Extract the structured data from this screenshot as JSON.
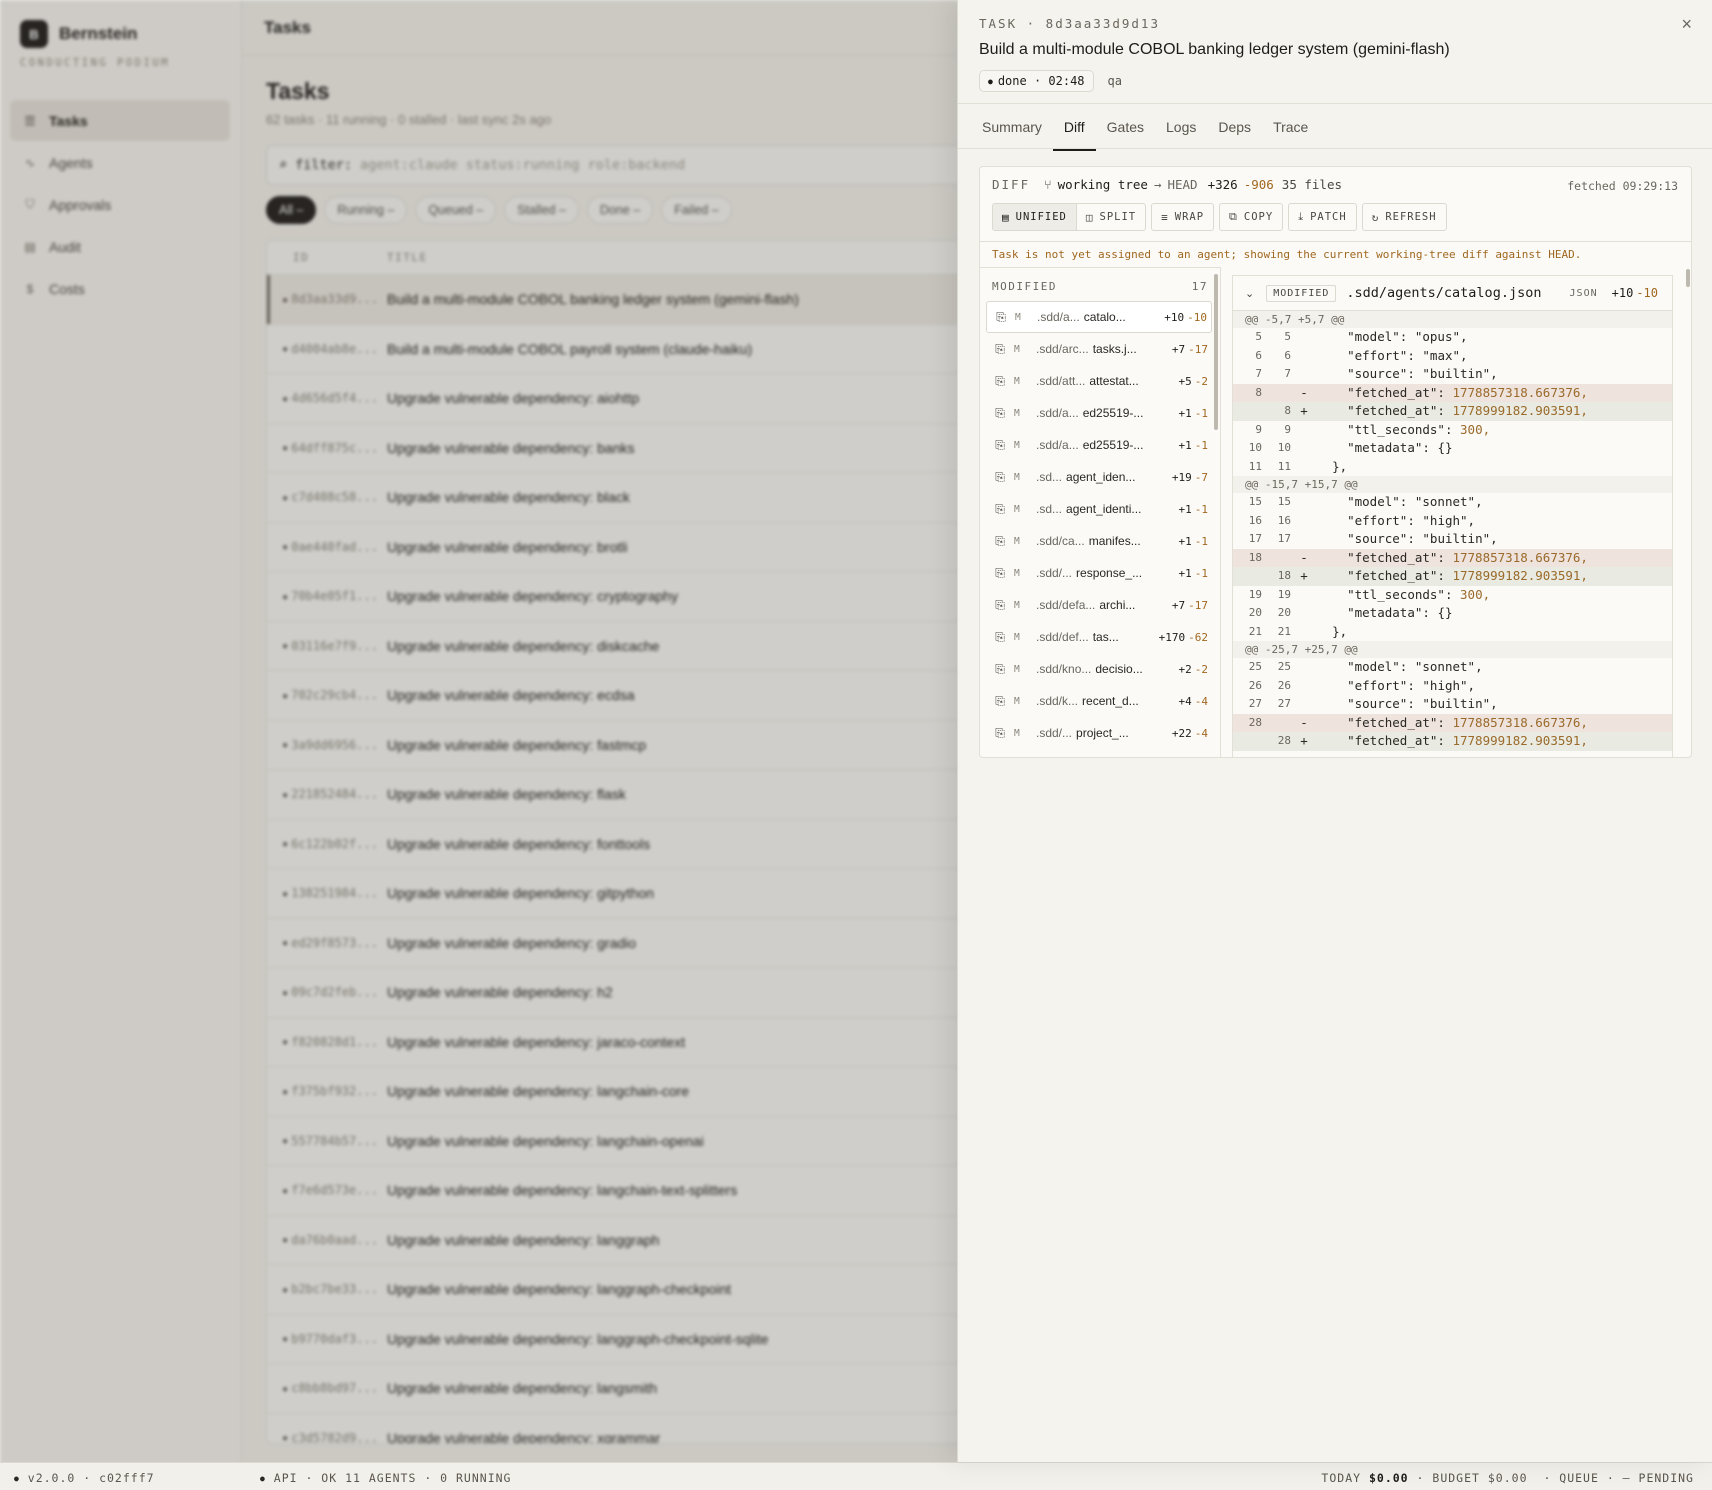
{
  "app": {
    "brand": "Bernstein",
    "logo_letter": "B",
    "tagline": "CONDUCTING PODIUM",
    "nav": [
      {
        "label": "Tasks",
        "icon": "list-icon",
        "active": true
      },
      {
        "label": "Agents",
        "icon": "pulse-icon",
        "active": false
      },
      {
        "label": "Approvals",
        "icon": "shield-check-icon",
        "active": false
      },
      {
        "label": "Audit",
        "icon": "ledger-icon",
        "active": false
      },
      {
        "label": "Costs",
        "icon": "dollar-icon",
        "active": false
      }
    ]
  },
  "main": {
    "topbar_title": "Tasks",
    "page_title": "Tasks",
    "summary": "62 tasks · 11 running · 0 stalled · last sync 2s  ago",
    "filter_key": "filter:",
    "filter_placeholder": "agent:claude status:running role:backend",
    "chips": [
      "All –",
      "Running –",
      "Queued –",
      "Stalled –",
      "Done –",
      "Failed –"
    ],
    "columns": {
      "id": "ID",
      "title": "TITLE"
    },
    "rows": [
      {
        "id": "8d3aa33d9...",
        "title": "Build a multi-module COBOL banking ledger system (gemini-flash)"
      },
      {
        "id": "d4004ab8e...",
        "title": "Build a multi-module COBOL payroll system (claude-haiku)"
      },
      {
        "id": "4d656d5f4...",
        "title": "Upgrade vulnerable dependency: aiohttp"
      },
      {
        "id": "64dff875c...",
        "title": "Upgrade vulnerable dependency: banks"
      },
      {
        "id": "c7d408c58...",
        "title": "Upgrade vulnerable dependency: black"
      },
      {
        "id": "0ae440fad...",
        "title": "Upgrade vulnerable dependency: brotli"
      },
      {
        "id": "70b4e05f1...",
        "title": "Upgrade vulnerable dependency: cryptography"
      },
      {
        "id": "03116e7f9...",
        "title": "Upgrade vulnerable dependency: diskcache"
      },
      {
        "id": "702c29cb4...",
        "title": "Upgrade vulnerable dependency: ecdsa"
      },
      {
        "id": "3a9dd6956...",
        "title": "Upgrade vulnerable dependency: fastmcp"
      },
      {
        "id": "221852484...",
        "title": "Upgrade vulnerable dependency: flask"
      },
      {
        "id": "6c122b02f...",
        "title": "Upgrade vulnerable dependency: fonttools"
      },
      {
        "id": "138251984...",
        "title": "Upgrade vulnerable dependency: gitpython"
      },
      {
        "id": "ed29f8573...",
        "title": "Upgrade vulnerable dependency: gradio"
      },
      {
        "id": "09c7d2feb...",
        "title": "Upgrade vulnerable dependency: h2"
      },
      {
        "id": "f820828d1...",
        "title": "Upgrade vulnerable dependency: jaraco-context"
      },
      {
        "id": "f375bf932...",
        "title": "Upgrade vulnerable dependency: langchain-core"
      },
      {
        "id": "557784b57...",
        "title": "Upgrade vulnerable dependency: langchain-openai"
      },
      {
        "id": "f7e6d573e...",
        "title": "Upgrade vulnerable dependency: langchain-text-splitters"
      },
      {
        "id": "da76b0aad...",
        "title": "Upgrade vulnerable dependency: langgraph"
      },
      {
        "id": "b2bc7be33...",
        "title": "Upgrade vulnerable dependency: langgraph-checkpoint"
      },
      {
        "id": "b9770daf3...",
        "title": "Upgrade vulnerable dependency: langgraph-checkpoint-sqlite"
      },
      {
        "id": "c8bb8bd97...",
        "title": "Upgrade vulnerable dependency: langsmith"
      },
      {
        "id": "c3d5782d9...",
        "title": "Upgrade vulnerable dependency: xgrammar"
      }
    ]
  },
  "footer": {
    "version": "v2.0.0 · c02fff7",
    "api": "API · OK   11 AGENTS · 0 RUNNING",
    "today_label": "TODAY",
    "today_value": "$0.00",
    "budget_label": "· BUDGET",
    "budget_value": "$0.00",
    "queue": "· QUEUE · — PENDING"
  },
  "drawer": {
    "eyebrow": "TASK · 8d3aa33d9d13",
    "title": "Build a multi-module COBOL banking ledger system (gemini-flash)",
    "status": "done · 02:48",
    "role": "qa",
    "tabs": [
      "Summary",
      "Diff",
      "Gates",
      "Logs",
      "Deps",
      "Trace"
    ],
    "active_tab": "Diff",
    "diff": {
      "label": "DIFF",
      "source": "working tree",
      "target": "HEAD",
      "additions": "+326",
      "deletions": "-906",
      "files": "35 files",
      "fetched": "fetched 09:29:13",
      "buttons": [
        {
          "label": "UNIFIED",
          "icon": "unified-icon"
        },
        {
          "label": "SPLIT",
          "icon": "split-icon"
        },
        {
          "label": "WRAP",
          "icon": "wrap-icon"
        },
        {
          "label": "COPY",
          "icon": "copy-icon"
        },
        {
          "label": "PATCH",
          "icon": "download-icon"
        },
        {
          "label": "REFRESH",
          "icon": "refresh-icon"
        }
      ],
      "notice": "Task is not yet assigned to an agent; showing the current working-tree diff against HEAD.",
      "list_label": "MODIFIED",
      "list_count": "17",
      "files_list": [
        {
          "path": ".sdd/a...",
          "name": "catalo...",
          "add": "+10",
          "del": "-10"
        },
        {
          "path": ".sdd/arc...",
          "name": "tasks.j...",
          "add": "+7",
          "del": "-17"
        },
        {
          "path": ".sdd/att...",
          "name": "attestat...",
          "add": "+5",
          "del": "-2"
        },
        {
          "path": ".sdd/a...",
          "name": "ed25519-...",
          "add": "+1",
          "del": "-1"
        },
        {
          "path": ".sdd/a...",
          "name": "ed25519-...",
          "add": "+1",
          "del": "-1"
        },
        {
          "path": ".sd...",
          "name": "agent_iden...",
          "add": "+19",
          "del": "-7"
        },
        {
          "path": ".sd...",
          "name": "agent_identi...",
          "add": "+1",
          "del": "-1"
        },
        {
          "path": ".sdd/ca...",
          "name": "manifes...",
          "add": "+1",
          "del": "-1"
        },
        {
          "path": ".sdd/...",
          "name": "response_...",
          "add": "+1",
          "del": "-1"
        },
        {
          "path": ".sdd/defa...",
          "name": "archi...",
          "add": "+7",
          "del": "-17"
        },
        {
          "path": ".sdd/def...",
          "name": "tas...",
          "add": "+170",
          "del": "-62"
        },
        {
          "path": ".sdd/kno...",
          "name": "decisio...",
          "add": "+2",
          "del": "-2"
        },
        {
          "path": ".sdd/k...",
          "name": "recent_d...",
          "add": "+4",
          "del": "-4"
        },
        {
          "path": ".sdd/...",
          "name": "project_...",
          "add": "+22",
          "del": "-4"
        }
      ],
      "file_panel": {
        "status": "MODIFIED",
        "path": ".sdd/agents/catalog.json",
        "lang": "JSON",
        "add": "+10",
        "del": "-10",
        "hunks": [
          {
            "header": "@@ -5,7 +5,7 @@",
            "lines": [
              {
                "o": "5",
                "n": "5",
                "t": "ctx",
                "key": "\"model\"",
                "val": "\"opus\","
              },
              {
                "o": "6",
                "n": "6",
                "t": "ctx",
                "key": "\"effort\"",
                "val": "\"max\","
              },
              {
                "o": "7",
                "n": "7",
                "t": "ctx",
                "key": "\"source\"",
                "val": "\"builtin\","
              },
              {
                "o": "8",
                "n": "",
                "t": "del",
                "key": "\"fetched_at\"",
                "val": "1778857318.667376,"
              },
              {
                "o": "",
                "n": "8",
                "t": "add",
                "key": "\"fetched_at\"",
                "val": "1778999182.903591,"
              },
              {
                "o": "9",
                "n": "9",
                "t": "ctx",
                "key": "\"ttl_seconds\"",
                "val": "300,"
              },
              {
                "o": "10",
                "n": "10",
                "t": "ctx",
                "key": "\"metadata\"",
                "val": "{}"
              },
              {
                "o": "11",
                "n": "11",
                "t": "close",
                "key": "},",
                "val": ""
              }
            ]
          },
          {
            "header": "@@ -15,7 +15,7 @@",
            "lines": [
              {
                "o": "15",
                "n": "15",
                "t": "ctx",
                "key": "\"model\"",
                "val": "\"sonnet\","
              },
              {
                "o": "16",
                "n": "16",
                "t": "ctx",
                "key": "\"effort\"",
                "val": "\"high\","
              },
              {
                "o": "17",
                "n": "17",
                "t": "ctx",
                "key": "\"source\"",
                "val": "\"builtin\","
              },
              {
                "o": "18",
                "n": "",
                "t": "del",
                "key": "\"fetched_at\"",
                "val": "1778857318.667376,"
              },
              {
                "o": "",
                "n": "18",
                "t": "add",
                "key": "\"fetched_at\"",
                "val": "1778999182.903591,"
              },
              {
                "o": "19",
                "n": "19",
                "t": "ctx",
                "key": "\"ttl_seconds\"",
                "val": "300,"
              },
              {
                "o": "20",
                "n": "20",
                "t": "ctx",
                "key": "\"metadata\"",
                "val": "{}"
              },
              {
                "o": "21",
                "n": "21",
                "t": "close",
                "key": "},",
                "val": ""
              }
            ]
          },
          {
            "header": "@@ -25,7 +25,7 @@",
            "lines": [
              {
                "o": "25",
                "n": "25",
                "t": "ctx",
                "key": "\"model\"",
                "val": "\"sonnet\","
              },
              {
                "o": "26",
                "n": "26",
                "t": "ctx",
                "key": "\"effort\"",
                "val": "\"high\","
              },
              {
                "o": "27",
                "n": "27",
                "t": "ctx",
                "key": "\"source\"",
                "val": "\"builtin\","
              },
              {
                "o": "28",
                "n": "",
                "t": "del",
                "key": "\"fetched_at\"",
                "val": "1778857318.667376,"
              },
              {
                "o": "",
                "n": "28",
                "t": "add",
                "key": "\"fetched_at\"",
                "val": "1778999182.903591,"
              }
            ]
          }
        ]
      }
    }
  }
}
